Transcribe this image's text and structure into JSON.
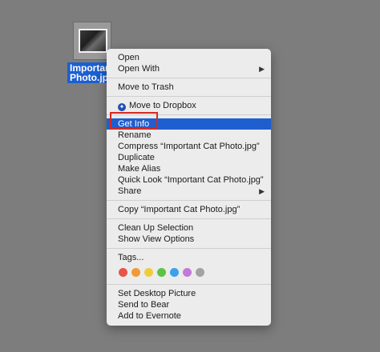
{
  "desktop": {
    "file": {
      "label_line1": "Important",
      "label_line2": "Photo.jpg"
    }
  },
  "menu": {
    "open": "Open",
    "open_with": "Open With",
    "move_to_trash": "Move to Trash",
    "move_to_dropbox": "Move to Dropbox",
    "get_info": "Get Info",
    "rename": "Rename",
    "compress": "Compress “Important Cat Photo.jpg”",
    "duplicate": "Duplicate",
    "make_alias": "Make Alias",
    "quick_look": "Quick Look “Important Cat Photo.jpg”",
    "share": "Share",
    "copy": "Copy “Important Cat Photo.jpg”",
    "clean_up_selection": "Clean Up Selection",
    "show_view_options": "Show View Options",
    "tags": "Tags...",
    "set_desktop_picture": "Set Desktop Picture",
    "send_to_bear": "Send to Bear",
    "add_to_evernote": "Add to Evernote",
    "submenu_arrow": "▶",
    "tag_colors": [
      "#e8534a",
      "#f19a35",
      "#f0cc3c",
      "#5cc445",
      "#3aa2ea",
      "#c27ad9",
      "#a3a3a3"
    ],
    "highlight_color": "#d62a1f",
    "selected_color": "#1e5ecf"
  }
}
